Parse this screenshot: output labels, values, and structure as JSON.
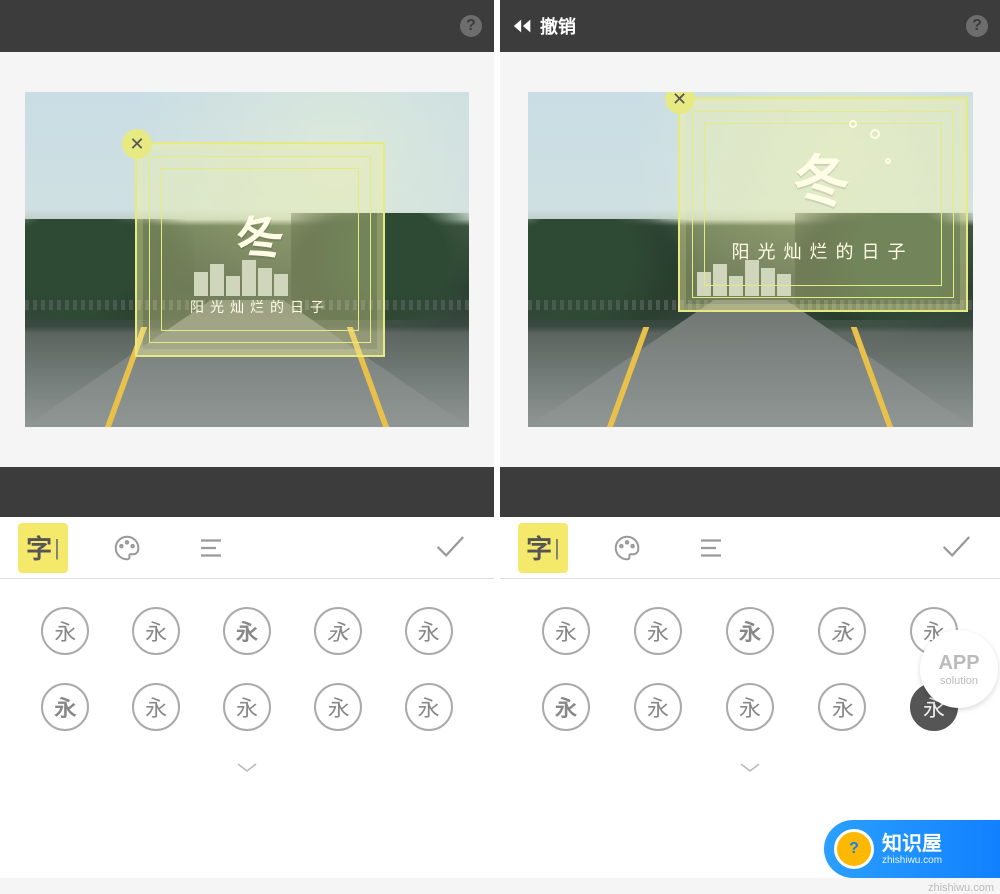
{
  "topbar": {
    "undo_label": "撤销",
    "help_glyph": "?"
  },
  "overlay": {
    "close_glyph": "✕",
    "title_char": "冬",
    "subtitle": "阳光灿烂的日子"
  },
  "tools": {
    "font_tab_label": "字",
    "confirm_glyph": "✓"
  },
  "fonts": {
    "sample_glyph": "永",
    "row1_count": 5,
    "row2_count": 5,
    "expand_glyph": "⌄",
    "right_selected_index": 9
  },
  "watermarks": {
    "app_line1": "APP",
    "app_line2": "solution",
    "zsw_title": "知识屋",
    "zsw_sub": "zhishiwu.com",
    "zsw_url": "zhishiwu.com"
  }
}
